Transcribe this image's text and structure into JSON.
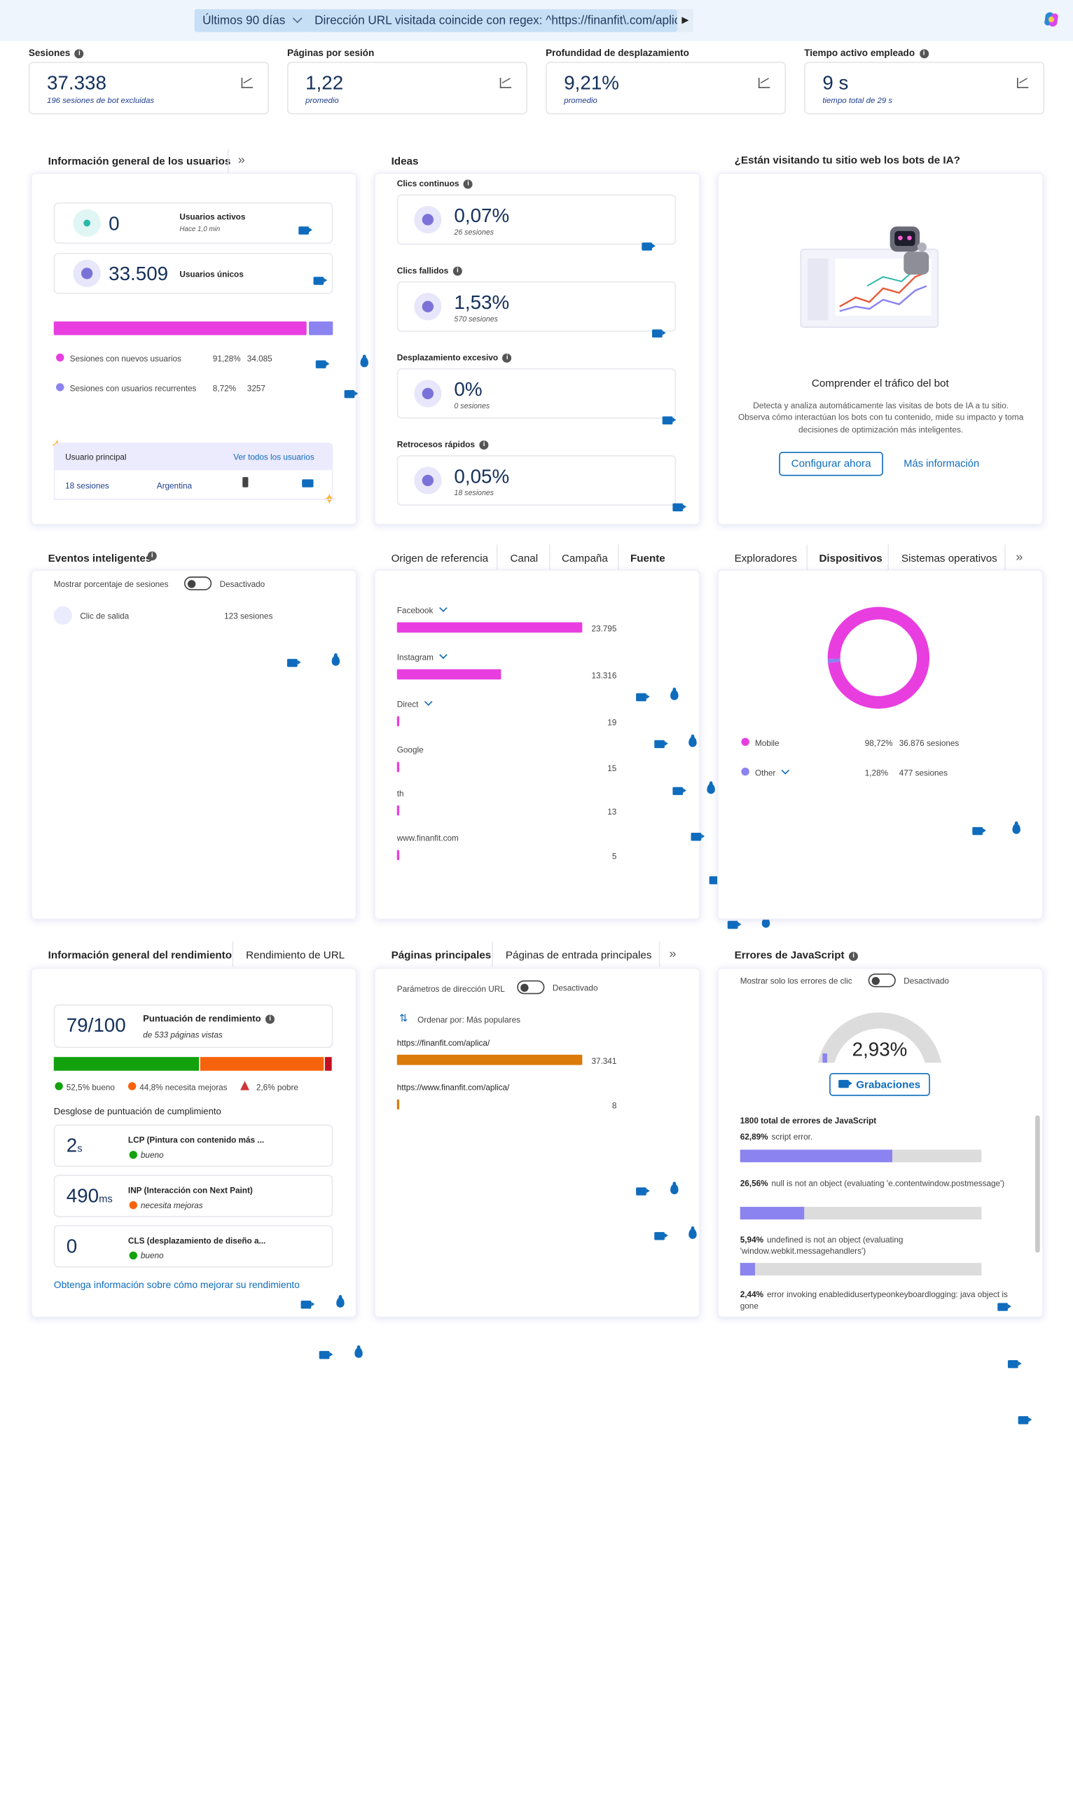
{
  "filters": {
    "date": "Últimos 90 días",
    "url": "Dirección URL visitada coincide con regex: ^https://finanfit\\.com/aplica/(\\?.*)?$"
  },
  "kpis": [
    {
      "title": "Sesiones",
      "value": "37.338",
      "sub": "196 sesiones de bot excluidas"
    },
    {
      "title": "Páginas por sesión",
      "value": "1,22",
      "sub": "promedio"
    },
    {
      "title": "Profundidad de desplazamiento",
      "value": "9,21%",
      "sub": "promedio"
    },
    {
      "title": "Tiempo activo empleado",
      "value": "9 s",
      "sub": "tiempo total de 29 s"
    }
  ],
  "users": {
    "title": "Información general de los usuarios",
    "active_value": "0",
    "active_label": "Usuarios activos",
    "active_sub": "Hace 1,0 min",
    "unique_value": "33.509",
    "unique_label": "Usuarios únicos",
    "new_label": "Sesiones con nuevos usuarios",
    "new_pct": "91,28%",
    "new_count": "34.085",
    "new_fraction": 0.9128,
    "ret_label": "Sesiones con usuarios recurrentes",
    "ret_pct": "8,72%",
    "ret_count": "3257",
    "principal_label": "Usuario principal",
    "see_all": "Ver todos los usuarios",
    "principal_sessions": "18 sesiones",
    "principal_country": "Argentina",
    "colors": {
      "new": "#e83ee0",
      "ret": "#8b83f0"
    }
  },
  "ideas": {
    "title": "Ideas",
    "items": [
      {
        "label": "Clics continuos",
        "value": "0,07%",
        "sub": "26 sesiones"
      },
      {
        "label": "Clics fallidos",
        "value": "1,53%",
        "sub": "570 sesiones"
      },
      {
        "label": "Desplazamiento excesivo",
        "value": "0%",
        "sub": "0 sesiones"
      },
      {
        "label": "Retrocesos rápidos",
        "value": "0,05%",
        "sub": "18 sesiones"
      }
    ]
  },
  "bots": {
    "title": "¿Están visitando tu sitio web los bots de IA?",
    "heading": "Comprender el tráfico del bot",
    "body": "Detecta y analiza automáticamente las visitas de bots de IA a tu sitio. Observa cómo interactúan los bots con tu contenido, mide su impacto y toma decisiones de optimización más inteligentes.",
    "configure": "Configurar ahora",
    "more": "Más información"
  },
  "smart": {
    "title": "Eventos inteligentes",
    "toggle_label": "Mostrar porcentaje de sesiones",
    "toggle_state": "Desactivado",
    "event": "Clic de salida",
    "event_count": "123 sesiones"
  },
  "referrer": {
    "tabs": [
      "Origen de referencia",
      "Canal",
      "Campaña",
      "Fuente"
    ],
    "rows": [
      {
        "label": "Facebook",
        "value": 23795,
        "display": "23.795",
        "dropdown": true
      },
      {
        "label": "Instagram",
        "value": 13316,
        "display": "13.316",
        "dropdown": true
      },
      {
        "label": "Direct",
        "value": 19,
        "display": "19",
        "dropdown": true
      },
      {
        "label": "Google",
        "value": 15,
        "display": "15",
        "dropdown": false
      },
      {
        "label": "th",
        "value": 13,
        "display": "13",
        "dropdown": false
      },
      {
        "label": "www.finanfit.com",
        "value": 5,
        "display": "5",
        "dropdown": false
      }
    ]
  },
  "devices": {
    "tabs": [
      "Exploradores",
      "Dispositivos",
      "Sistemas operativos"
    ],
    "rows": [
      {
        "label": "Mobile",
        "pct": "98,72%",
        "count": "36.876 sesiones",
        "color": "#e83ee0",
        "fraction": 0.9872
      },
      {
        "label": "Other",
        "pct": "1,28%",
        "count": "477 sesiones",
        "color": "#8b83f0",
        "fraction": 0.0128
      }
    ]
  },
  "perf": {
    "tabs": [
      "Información general del rendimiento",
      "Rendimiento de URL"
    ],
    "score": "79/100",
    "score_label": "Puntuación de rendimiento",
    "score_sub": "de 533 páginas vistas",
    "good": "52,5% bueno",
    "mid": "44,8% necesita mejoras",
    "poor": "2,6% pobre",
    "fractions": [
      0.525,
      0.448,
      0.026
    ],
    "breakdown": "Desglose de puntuación de cumplimiento",
    "metrics": [
      {
        "value": "2",
        "unit": "s",
        "label": "LCP (Pintura con contenido más ...",
        "status": "bueno",
        "color": "#13a10e"
      },
      {
        "value": "490",
        "unit": "ms",
        "label": "INP (Interacción con Next Paint)",
        "status": "necesita mejoras",
        "color": "#f7630c"
      },
      {
        "value": "0",
        "unit": "",
        "label": "CLS (desplazamiento de diseño a...",
        "status": "bueno",
        "color": "#13a10e"
      }
    ],
    "link": "Obtenga información sobre cómo mejorar su rendimiento"
  },
  "pages": {
    "tabs": [
      "Páginas principales",
      "Páginas de entrada principales"
    ],
    "toggle_label": "Parámetros de dirección URL",
    "toggle_state": "Desactivado",
    "sort": "Ordenar por: Más populares",
    "rows": [
      {
        "url": "https://finanfit.com/aplica/",
        "value": 37341,
        "display": "37.341"
      },
      {
        "url": "https://www.finanfit.com/aplica/",
        "value": 8,
        "display": "8"
      }
    ]
  },
  "js": {
    "title": "Errores de JavaScript",
    "toggle_label": "Mostrar solo los errores de clic",
    "toggle_state": "Desactivado",
    "rate": "2,93%",
    "rate_fraction": 0.0293,
    "recordings": "Grabaciones",
    "total": "1800 total de errores de JavaScript",
    "errors": [
      {
        "pct": "62,89%",
        "text": "script error.",
        "fraction": 0.6289
      },
      {
        "pct": "26,56%",
        "text": "null is not an object (evaluating 'e.contentwindow.postmessage')",
        "fraction": 0.2656
      },
      {
        "pct": "5,94%",
        "text": "undefined is not an object (evaluating 'window.webkit.messagehandlers')",
        "fraction": 0.0594
      },
      {
        "pct": "2,44%",
        "text": "error invoking enabledidusertypeonkeyboardlogging: java object is gone",
        "fraction": 0.0244
      }
    ]
  }
}
